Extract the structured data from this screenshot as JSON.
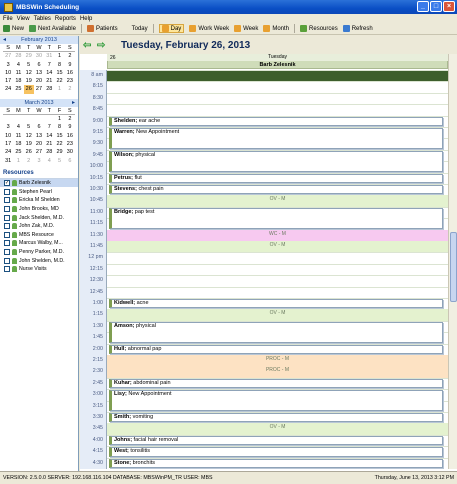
{
  "window": {
    "title": "MBSWin Scheduling"
  },
  "menu": [
    "File",
    "View",
    "Tables",
    "Reports",
    "Help"
  ],
  "toolbar": [
    {
      "label": "New",
      "icon": "new-icon",
      "color": "#3a8a3a"
    },
    {
      "label": "Next Available",
      "icon": "next-available-icon",
      "color": "#4a9a4a"
    },
    {
      "label": "Patients",
      "icon": "patients-icon",
      "color": "#d07030"
    },
    {
      "label": "Today",
      "icon": "today-icon",
      "color": "#ece9d8"
    },
    {
      "label": "Day",
      "icon": "day-icon",
      "color": "#e8a030",
      "active": true
    },
    {
      "label": "Work Week",
      "icon": "work-week-icon",
      "color": "#e8a030"
    },
    {
      "label": "Week",
      "icon": "week-icon",
      "color": "#e8a030"
    },
    {
      "label": "Month",
      "icon": "month-icon",
      "color": "#e8a030"
    },
    {
      "label": "Resources",
      "icon": "resources-icon",
      "color": "#5aa03a"
    },
    {
      "label": "Refresh",
      "icon": "refresh-icon",
      "color": "#3a7ad0"
    }
  ],
  "feb": {
    "title": "February 2013",
    "dows": [
      "S",
      "M",
      "T",
      "W",
      "T",
      "F",
      "S"
    ],
    "days": [
      [
        "27",
        1
      ],
      [
        "28",
        1
      ],
      [
        "29",
        1
      ],
      [
        "30",
        1
      ],
      [
        "31",
        1
      ],
      [
        "1",
        0
      ],
      [
        "2",
        0
      ],
      [
        "3",
        0
      ],
      [
        "4",
        0
      ],
      [
        "5",
        0
      ],
      [
        "6",
        0
      ],
      [
        "7",
        0
      ],
      [
        "8",
        0
      ],
      [
        "9",
        0
      ],
      [
        "10",
        0
      ],
      [
        "11",
        0
      ],
      [
        "12",
        0
      ],
      [
        "13",
        0
      ],
      [
        "14",
        0
      ],
      [
        "15",
        0
      ],
      [
        "16",
        0
      ],
      [
        "17",
        0
      ],
      [
        "18",
        0
      ],
      [
        "19",
        0
      ],
      [
        "20",
        0
      ],
      [
        "21",
        0
      ],
      [
        "22",
        0
      ],
      [
        "23",
        0
      ],
      [
        "24",
        0
      ],
      [
        "25",
        0
      ],
      [
        "26",
        2
      ],
      [
        "27",
        0
      ],
      [
        "28",
        0
      ],
      [
        "1",
        1
      ],
      [
        "2",
        1
      ]
    ]
  },
  "mar": {
    "title": "March 2013",
    "dows": [
      "S",
      "M",
      "T",
      "W",
      "T",
      "F",
      "S"
    ],
    "days": [
      [
        "",
        0
      ],
      [
        "",
        0
      ],
      [
        "",
        0
      ],
      [
        "",
        0
      ],
      [
        "",
        0
      ],
      [
        "1",
        0
      ],
      [
        "2",
        0
      ],
      [
        "3",
        0
      ],
      [
        "4",
        0
      ],
      [
        "5",
        0
      ],
      [
        "6",
        0
      ],
      [
        "7",
        0
      ],
      [
        "8",
        0
      ],
      [
        "9",
        0
      ],
      [
        "10",
        0
      ],
      [
        "11",
        0
      ],
      [
        "12",
        0
      ],
      [
        "13",
        0
      ],
      [
        "14",
        0
      ],
      [
        "15",
        0
      ],
      [
        "16",
        0
      ],
      [
        "17",
        0
      ],
      [
        "18",
        0
      ],
      [
        "19",
        0
      ],
      [
        "20",
        0
      ],
      [
        "21",
        0
      ],
      [
        "22",
        0
      ],
      [
        "23",
        0
      ],
      [
        "24",
        0
      ],
      [
        "25",
        0
      ],
      [
        "26",
        0
      ],
      [
        "27",
        0
      ],
      [
        "28",
        0
      ],
      [
        "29",
        0
      ],
      [
        "30",
        0
      ],
      [
        "31",
        0
      ],
      [
        "1",
        1
      ],
      [
        "2",
        1
      ],
      [
        "3",
        1
      ],
      [
        "4",
        1
      ],
      [
        "5",
        1
      ],
      [
        "6",
        1
      ]
    ]
  },
  "resources": {
    "title": "Resources",
    "items": [
      {
        "label": "Barb Zelesnik",
        "checked": true
      },
      {
        "label": "Stephen Pearl",
        "checked": false
      },
      {
        "label": "Ericka M Shelden",
        "checked": false
      },
      {
        "label": "John Brooks, MD",
        "checked": false
      },
      {
        "label": "Jack Shelden, M.D.",
        "checked": false
      },
      {
        "label": "John Zak, M.D.",
        "checked": false
      },
      {
        "label": "MBS Resource",
        "checked": false
      },
      {
        "label": "Marcus Walby, M...",
        "checked": false
      },
      {
        "label": "Penny Parker, M.D.",
        "checked": false
      },
      {
        "label": "John Shelden, M.D.",
        "checked": false
      },
      {
        "label": "Nurse Visits",
        "checked": false
      }
    ]
  },
  "schedule": {
    "date_title": "Tuesday, February 26, 2013",
    "day_num": "26",
    "day_name": "Tuesday",
    "resource": "Barb Zelesnik",
    "times": [
      "8 am",
      "8:15",
      "8:30",
      "8:45",
      "9:00",
      "9:15",
      "9:30",
      "9:45",
      "10:00",
      "10:15",
      "10:30",
      "10:45",
      "11:00",
      "11:15",
      "11:30",
      "11:45",
      "12 pm",
      "12:15",
      "12:30",
      "12:45",
      "1:00",
      "1:15",
      "1:30",
      "1:45",
      "2:00",
      "2:15",
      "2:30",
      "2:45",
      "3:00",
      "3:15",
      "3:30",
      "3:45",
      "4:00",
      "4:15",
      "4:30"
    ],
    "appointments": [
      {
        "name": "Shelden;",
        "note": "ear ache",
        "slot": 4,
        "len": 1
      },
      {
        "name": "Warren;",
        "note": "New Appointment",
        "slot": 5,
        "len": 2
      },
      {
        "name": "Wilson;",
        "note": "physical",
        "slot": 7,
        "len": 2
      },
      {
        "name": "Petrus;",
        "note": "flut",
        "slot": 9,
        "len": 1
      },
      {
        "name": "Stevens;",
        "note": "chest pain",
        "slot": 10,
        "len": 1
      },
      {
        "name": "Bridge;",
        "note": "pap test",
        "slot": 12,
        "len": 2
      },
      {
        "name": "Kidwell;",
        "note": "acne",
        "slot": 20,
        "len": 1
      },
      {
        "name": "Amson;",
        "note": "physical",
        "slot": 22,
        "len": 2
      },
      {
        "name": "Hull;",
        "note": "abnormal pap",
        "slot": 24,
        "len": 1
      },
      {
        "name": "Kuhar;",
        "note": "abdominal pain",
        "slot": 27,
        "len": 1
      },
      {
        "name": "Lisy;",
        "note": "New Appointment",
        "slot": 28,
        "len": 2
      },
      {
        "name": "Smith;",
        "note": "vomiting",
        "slot": 30,
        "len": 1
      },
      {
        "name": "Johns;",
        "note": "facial hair removal",
        "slot": 32,
        "len": 1
      },
      {
        "name": "West;",
        "note": "tonsilitis",
        "slot": 33,
        "len": 1
      },
      {
        "name": "Stone;",
        "note": "bronchits",
        "slot": 34,
        "len": 1
      }
    ],
    "bands": [
      {
        "label": "OV - M",
        "slot": 11,
        "color": "#e4f2cf"
      },
      {
        "label": "WC - M",
        "slot": 14,
        "color": "#f7c9f0"
      },
      {
        "label": "OV - M",
        "slot": 15,
        "color": "#e4f2cf"
      },
      {
        "label": "OV - M",
        "slot": 21,
        "color": "#e4f2cf"
      },
      {
        "label": "PROC - M",
        "slot": 25,
        "color": "#fde2c3"
      },
      {
        "label": "PROC - M",
        "slot": 26,
        "color": "#fde2c3"
      },
      {
        "label": "OV - M",
        "slot": 31,
        "color": "#e4f2cf"
      }
    ]
  },
  "status": {
    "left": "VERSION: 2.5.0.0  SERVER: 192.168.116.104  DATABASE: MBSWinPM_TR  USER: MBS",
    "right": "Thursday, June 13, 2013  3:12 PM"
  }
}
